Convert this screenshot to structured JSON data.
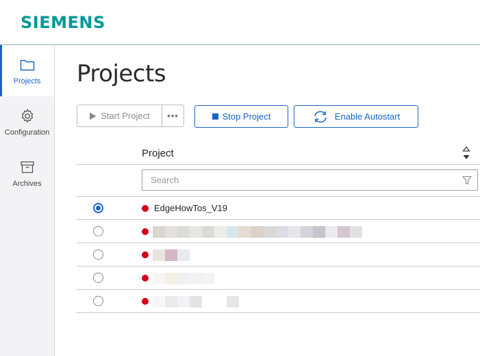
{
  "brand": {
    "logo": "SIEMENS"
  },
  "sidebar": {
    "items": [
      {
        "label": "Projects",
        "icon": "folder-icon",
        "active": true
      },
      {
        "label": "Configuration",
        "icon": "gear-icon",
        "active": false
      },
      {
        "label": "Archives",
        "icon": "archive-box-icon",
        "active": false
      }
    ]
  },
  "main": {
    "title": "Projects",
    "toolbar": {
      "start_label": "Start Project",
      "more_label": "•••",
      "stop_label": "Stop Project",
      "autostart_label": "Enable Autostart"
    },
    "table": {
      "column_project": "Project",
      "search_placeholder": "Search",
      "rows": [
        {
          "name": "EdgeHowTos_V19",
          "selected": true,
          "status": "stopped"
        },
        {
          "name": "",
          "selected": false,
          "status": "stopped"
        },
        {
          "name": "",
          "selected": false,
          "status": "stopped"
        },
        {
          "name": "",
          "selected": false,
          "status": "stopped"
        },
        {
          "name": "",
          "selected": false,
          "status": "stopped"
        }
      ]
    }
  },
  "colors": {
    "accent": "#1a63c6",
    "brand": "#009999",
    "status_stopped": "#d4001a"
  }
}
